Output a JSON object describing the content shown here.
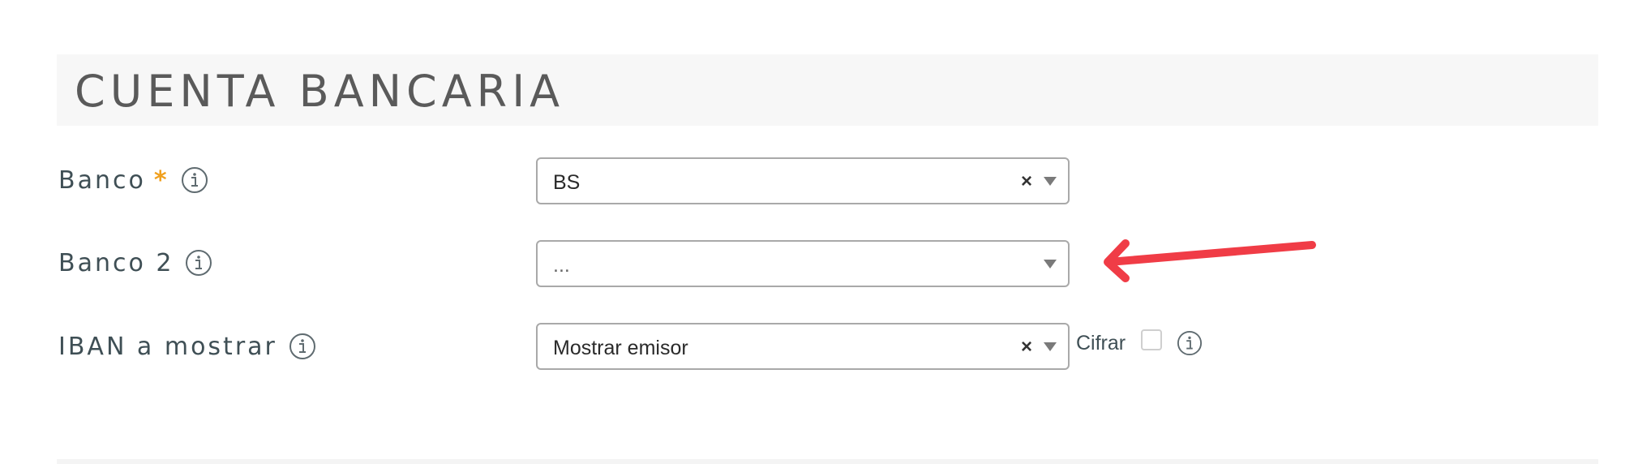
{
  "section": {
    "title": "CUENTA BANCARIA"
  },
  "fields": {
    "banco": {
      "label": "Banco",
      "required_mark": "*",
      "value": "BS",
      "clear_symbol": "×"
    },
    "banco2": {
      "label": "Banco 2",
      "value": "..."
    },
    "iban": {
      "label": "IBAN a mostrar",
      "value": "Mostrar emisor",
      "clear_symbol": "×",
      "cifrar_label": "Cifrar"
    }
  },
  "colors": {
    "required": "#f0a01e",
    "annotation_arrow": "#f03c46",
    "label_text": "#3f4f55"
  },
  "icons": {
    "info": "info-circle-icon",
    "caret": "caret-down-icon",
    "clear": "clear-x-icon",
    "annotation": "red-arrow-annotation"
  }
}
